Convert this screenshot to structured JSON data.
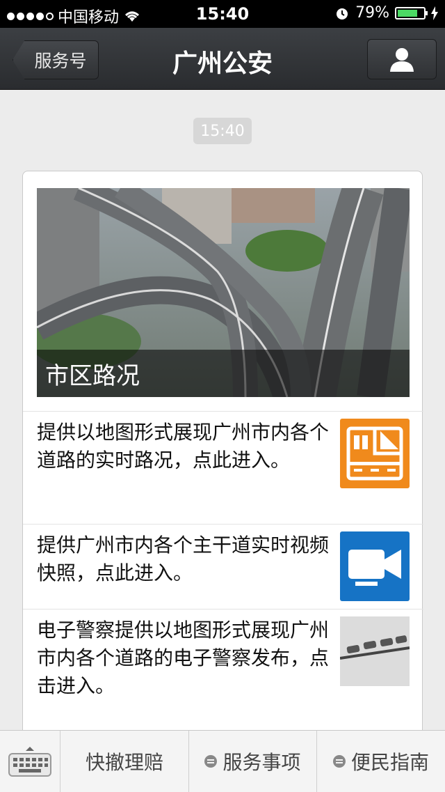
{
  "status_bar": {
    "carrier": "中国移动",
    "time": "15:40",
    "battery": "79%",
    "battery_level": 0.79
  },
  "nav": {
    "back_label": "服务号",
    "title": "广州公安"
  },
  "chat": {
    "timestamp": "15:40",
    "cover_caption": "市区路况",
    "rows": [
      {
        "text": "提供以地图形式展现广州市内各个道路的实时路况，点此进入。",
        "icon": "traffic-map-icon"
      },
      {
        "text": "提供广州市内各个主干道实时视频快照，点此进入。",
        "icon": "video-camera-icon"
      },
      {
        "text": "电子警察提供以地图形式展现广州市内各个道路的电子警察发布，点击进入。",
        "icon": "surveillance-camera-photo"
      }
    ]
  },
  "toolbar": {
    "menu1": "快撤理赔",
    "menu2": "服务事项",
    "menu3": "便民指南"
  },
  "colors": {
    "orange_icon": "#f08a1c",
    "blue_icon": "#1673c5",
    "nav_bg": "#2e3033"
  }
}
